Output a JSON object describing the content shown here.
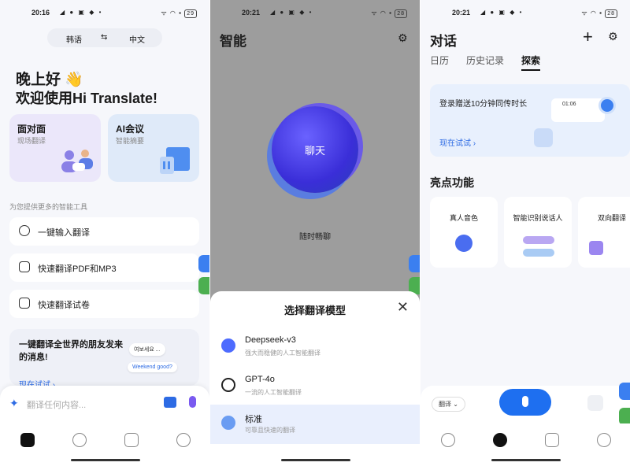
{
  "p1": {
    "time": "20:16",
    "battery": "29",
    "lang_from": "韩语",
    "lang_swap": "⇆",
    "lang_to": "中文",
    "greeting": "晚上好 👋",
    "welcome": "欢迎使用Hi Translate!",
    "card_face_title": "面对面",
    "card_face_sub": "现场翻译",
    "card_ai_title": "AI会议",
    "card_ai_sub": "智能摘要",
    "tools_title": "为您提供更多的智能工具",
    "tools": [
      "一键输入翻译",
      "快速翻译PDF和MP3",
      "快速翻译试卷"
    ],
    "promo_title": "一键翻译全世界的朋友发来的消息!",
    "promo_cta": "现在试试 ›",
    "bubble1": "여보세요 ...",
    "bubble2": "Weekend good?",
    "input_placeholder": "翻译任何内容..."
  },
  "p2": {
    "time": "20:21",
    "battery": "28",
    "title": "智能",
    "blob_label": "聊天",
    "subtitle": "随时畅聊",
    "sheet_title": "选择翻译模型",
    "models": [
      {
        "name": "Deepseek-v3",
        "desc": "强大而稳健的人工智能翻译"
      },
      {
        "name": "GPT-4o",
        "desc": "一流的人工智能翻译"
      },
      {
        "name": "标准",
        "desc": "可靠且快速的翻译"
      }
    ]
  },
  "p3": {
    "time": "20:21",
    "battery": "28",
    "title": "对话",
    "tabs": [
      "日历",
      "历史记录",
      "探索"
    ],
    "banner_title": "登录赠送10分钟同传时长",
    "banner_cta": "现在试试 ›",
    "banner_time": "01:06",
    "section": "亮点功能",
    "features": [
      "真人音色",
      "智能识别说话人",
      "双向翻译"
    ],
    "chip": "翻译 ⌄"
  },
  "colors": {
    "accent": "#1e6ff0",
    "link": "#2d6be4"
  }
}
